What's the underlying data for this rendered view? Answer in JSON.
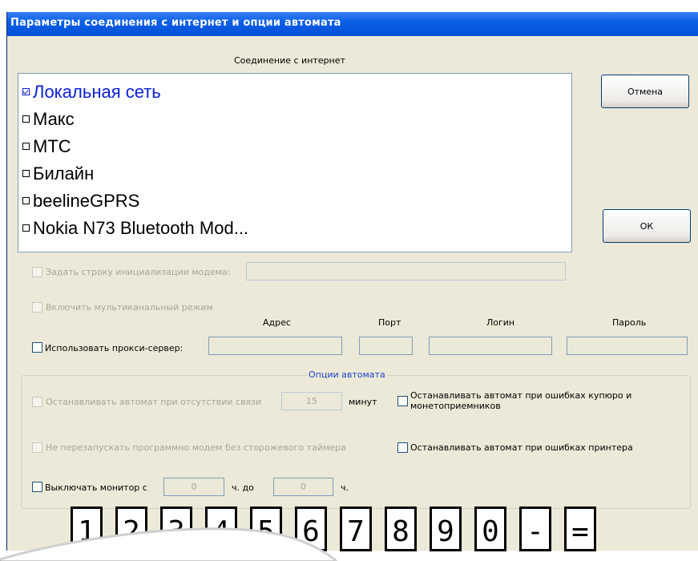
{
  "window": {
    "title": "Параметры соединения с интернет и опции автомата"
  },
  "connection": {
    "header": "Соединение с интернет",
    "items": [
      {
        "label": "Локальная сеть",
        "checked": true
      },
      {
        "label": "Макс",
        "checked": false
      },
      {
        "label": "МТС",
        "checked": false
      },
      {
        "label": "Билайн",
        "checked": false
      },
      {
        "label": "beelineGPRS",
        "checked": false
      },
      {
        "label": "Nokia N73 Bluetooth Mod...",
        "checked": false
      }
    ]
  },
  "buttons": {
    "cancel": "Отмена",
    "ok": "ОК"
  },
  "modem": {
    "init_label": "Задать строку инициализации модема:",
    "init_value": "",
    "multichannel_label": "Включить мультиканальный режим"
  },
  "proxy": {
    "label": "Использовать прокси-сервер:",
    "columns": {
      "address": "Адрес",
      "port": "Порт",
      "login": "Логин",
      "password": "Пароль"
    },
    "values": {
      "address": "",
      "port": "",
      "login": "",
      "password": ""
    }
  },
  "options": {
    "title": "Опции автомата",
    "stop_no_link": "Останавливать автомат при отсутствии связи",
    "stop_no_link_value": "15",
    "minutes_unit": "минут",
    "stop_bill_errors": "Останавливать автомат при ошибках купюро и монетоприемников",
    "no_restart_modem": "Не перезапускать программно модем  без сторожевого таймера",
    "stop_printer_errors": "Останавливать автомат при ошибках принтера",
    "monitor_off_label": "Выключать монитор с",
    "monitor_from_value": "0",
    "hours_unit_1": "ч.  до",
    "monitor_to_value": "0",
    "hours_unit_2": "ч."
  },
  "keyboard": {
    "keys": [
      "1",
      "2",
      "3",
      "4",
      "5",
      "6",
      "7",
      "8",
      "9",
      "0",
      "-",
      "="
    ]
  },
  "colors": {
    "titlebar": "#0A5FE8",
    "window_bg": "#ECE9D8",
    "selected_item": "#0A20D8"
  }
}
